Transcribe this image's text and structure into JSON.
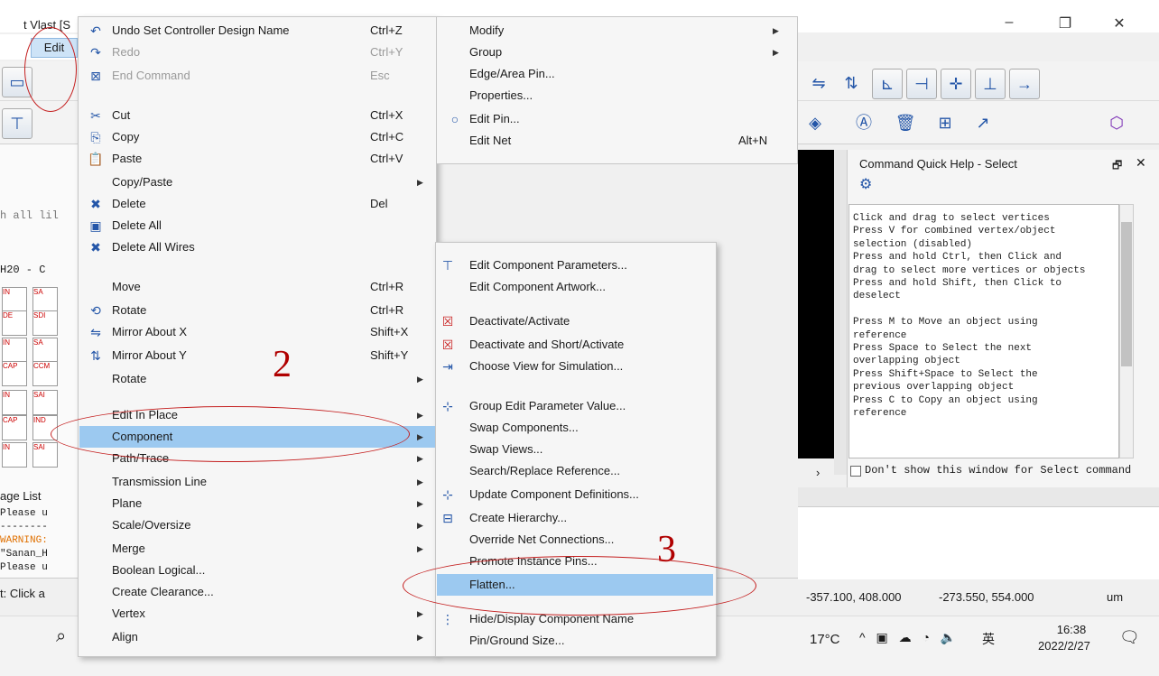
{
  "app": {
    "title": "t Vlast [S",
    "menu_edit": "Edit",
    "lib_filter": "h all lil",
    "lib_name": "H20 - C",
    "message_list_tab": "age List",
    "messages": [
      "Please u",
      "--------",
      "WARNING:",
      "\"Sanan_H",
      "Please u"
    ],
    "status_text": "t: Click a",
    "palette": [
      "IN",
      "SA",
      "DE",
      "SDI",
      "IN",
      "SA",
      "CAP",
      "CCM",
      "IN",
      "SAI",
      "CAP",
      "IND",
      "IN",
      "SAI"
    ]
  },
  "window_controls": {
    "minimize": "–",
    "restore": "❐",
    "close": "✕"
  },
  "edit_menu": {
    "items": [
      {
        "label": "Undo Set Controller Design Name",
        "shortcut": "Ctrl+Z",
        "icon": "undo-icon",
        "disabled": false
      },
      {
        "label": "Redo",
        "shortcut": "Ctrl+Y",
        "icon": "redo-icon",
        "disabled": true
      },
      {
        "label": "End Command",
        "shortcut": "Esc",
        "icon": "end-command-icon",
        "disabled": true
      },
      {
        "label": "Cut",
        "shortcut": "Ctrl+X",
        "icon": "cut-icon",
        "disabled": false
      },
      {
        "label": "Copy",
        "shortcut": "Ctrl+C",
        "icon": "copy-icon",
        "disabled": false
      },
      {
        "label": "Paste",
        "shortcut": "Ctrl+V",
        "icon": "paste-icon",
        "disabled": false
      },
      {
        "label": "Copy/Paste",
        "shortcut": "",
        "icon": "",
        "submenu": true
      },
      {
        "label": "Delete",
        "shortcut": "Del",
        "icon": "delete-icon"
      },
      {
        "label": "Delete All",
        "shortcut": "",
        "icon": "delete-all-icon"
      },
      {
        "label": "Delete All Wires",
        "shortcut": "",
        "icon": "delete-wires-icon"
      },
      {
        "label": "Move",
        "shortcut": "Ctrl+R",
        "icon": ""
      },
      {
        "label": "Rotate",
        "shortcut": "Ctrl+R",
        "icon": "rotate-icon"
      },
      {
        "label": "Mirror About X",
        "shortcut": "Shift+X",
        "icon": "mirror-x-icon"
      },
      {
        "label": "Mirror About Y",
        "shortcut": "Shift+Y",
        "icon": "mirror-y-icon"
      },
      {
        "label": "Rotate",
        "shortcut": "",
        "icon": "",
        "submenu": true
      },
      {
        "label": "Edit In Place",
        "shortcut": "",
        "submenu": true
      },
      {
        "label": "Component",
        "shortcut": "",
        "submenu": true,
        "highlighted": true
      },
      {
        "label": "Path/Trace",
        "shortcut": "",
        "submenu": true
      },
      {
        "label": "Transmission Line",
        "shortcut": "",
        "submenu": true
      },
      {
        "label": "Plane",
        "shortcut": "",
        "submenu": true
      },
      {
        "label": "Scale/Oversize",
        "shortcut": "",
        "submenu": true
      },
      {
        "label": "Merge",
        "shortcut": "",
        "submenu": true
      },
      {
        "label": "Boolean Logical...",
        "shortcut": ""
      },
      {
        "label": "Create Clearance...",
        "shortcut": ""
      },
      {
        "label": "Vertex",
        "shortcut": "",
        "submenu": true
      },
      {
        "label": "Align",
        "shortcut": "",
        "submenu": true
      }
    ]
  },
  "modify_menu": {
    "items": [
      {
        "label": "Modify",
        "shortcut": "",
        "submenu": true
      },
      {
        "label": "Group",
        "shortcut": "",
        "submenu": true
      },
      {
        "label": "Edge/Area Pin...",
        "shortcut": ""
      },
      {
        "label": "Properties...",
        "shortcut": ""
      },
      {
        "label": "Edit Pin...",
        "shortcut": "",
        "icon": "edit-pin-icon"
      },
      {
        "label": "Edit Net",
        "shortcut": "Alt+N"
      }
    ]
  },
  "component_menu": {
    "items": [
      {
        "label": "Edit Component Parameters...",
        "icon": "edit-params-icon"
      },
      {
        "label": "Edit Component Artwork..."
      },
      {
        "label": "Deactivate/Activate",
        "icon": "deactivate-icon"
      },
      {
        "label": "Deactivate and Short/Activate",
        "icon": "deactivate-short-icon"
      },
      {
        "label": "Choose View for Simulation...",
        "icon": "choose-view-icon"
      },
      {
        "label": "Group Edit Parameter Value...",
        "icon": "group-edit-icon"
      },
      {
        "label": "Swap Components..."
      },
      {
        "label": "Swap Views..."
      },
      {
        "label": "Search/Replace Reference..."
      },
      {
        "label": "Update Component Definitions...",
        "icon": "update-icon"
      },
      {
        "label": "Create Hierarchy...",
        "icon": "hierarchy-icon"
      },
      {
        "label": "Override Net Connections..."
      },
      {
        "label": "Promote Instance Pins..."
      },
      {
        "label": "Flatten...",
        "highlighted": true
      },
      {
        "label": "Hide/Display Component Name",
        "icon": "name-icon"
      },
      {
        "label": "Pin/Ground Size..."
      }
    ]
  },
  "help_panel": {
    "title": "Command Quick Help - Select",
    "text": "Click and drag to select vertices\nPress V for combined vertex/object\nselection (disabled)\nPress and hold Ctrl, then Click and\ndrag to select more vertices or objects\nPress and hold Shift, then Click to\ndeselect\n\nPress M to Move an object using\nreference\nPress Space to Select the next\noverlapping object\nPress Shift+Space to Select the\nprevious overlapping object\nPress C to Copy an object using\nreference",
    "dont_show": "Don't show this window for Select command"
  },
  "status": {
    "coord1": "-357.100, 408.000",
    "coord2": "-273.550, 554.000",
    "units": "um"
  },
  "taskbar": {
    "weather": "17°C",
    "ime": "英",
    "time": "16:38",
    "date": "2022/2/27"
  },
  "annotations": {
    "step2": "2",
    "step3": "3"
  },
  "colors": {
    "highlight": "#9cc9f0",
    "annotation": "#c41e1e"
  }
}
